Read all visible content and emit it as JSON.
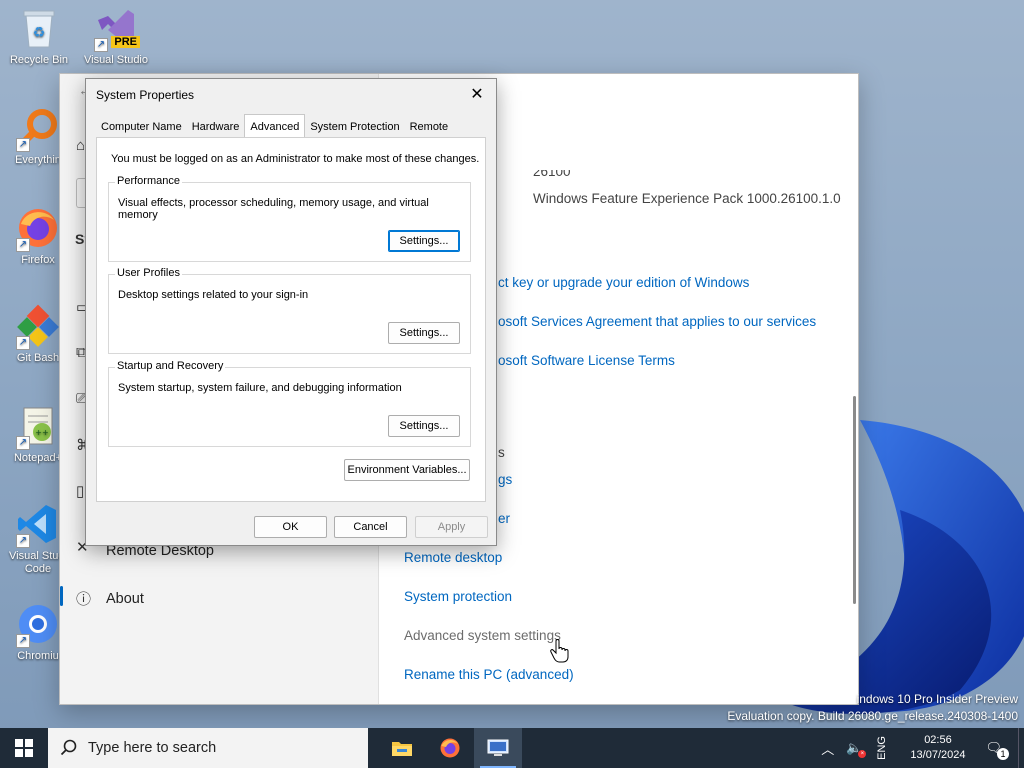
{
  "desktop": {
    "icons": [
      {
        "label": "Recycle Bin",
        "icon": "recycle-bin-icon"
      },
      {
        "label": "Visual Studio",
        "badge": "PRE",
        "icon": "visual-studio-icon"
      },
      {
        "label": "Everythin",
        "icon": "everything-search-icon"
      },
      {
        "label": "Firefox",
        "icon": "firefox-icon"
      },
      {
        "label": "Git Bash",
        "icon": "git-bash-icon"
      },
      {
        "label": "Notepad+",
        "icon": "notepad-plus-plus-icon"
      },
      {
        "label": "Visual Studi Code",
        "icon": "vscode-icon"
      },
      {
        "label": "Chromiu",
        "icon": "chromium-icon"
      }
    ],
    "watermark": {
      "line1": "indows 10 Pro Insider Preview",
      "line2": "Evaluation copy. Build 26080.ge_release.240308-1400"
    }
  },
  "settings_window": {
    "nav": {
      "partial_label": "Sy",
      "items": [
        "Remote Desktop",
        "About"
      ]
    },
    "content": {
      "partial_version": "26100",
      "feature_pack": "Windows Feature Experience Pack 1000.26100.1.0",
      "links": [
        "ct key or upgrade your edition of Windows",
        "osoft Services Agreement that applies to our services",
        "osoft Software License Terms"
      ],
      "related_header_fragment": "s",
      "partial_links": [
        "gs",
        "er"
      ],
      "related_links": [
        {
          "label": "Remote desktop"
        },
        {
          "label": "System protection"
        },
        {
          "label": "Advanced system settings"
        },
        {
          "label": "Rename this PC (advanced)"
        }
      ]
    }
  },
  "dialog": {
    "title": "System Properties",
    "tabs": [
      "Computer Name",
      "Hardware",
      "Advanced",
      "System Protection",
      "Remote"
    ],
    "active_tab": "Advanced",
    "admin_note": "You must be logged on as an Administrator to make most of these changes.",
    "groups": [
      {
        "title": "Performance",
        "desc": "Visual effects, processor scheduling, memory usage, and virtual memory",
        "button": "Settings..."
      },
      {
        "title": "User Profiles",
        "desc": "Desktop settings related to your sign-in",
        "button": "Settings..."
      },
      {
        "title": "Startup and Recovery",
        "desc": "System startup, system failure, and debugging information",
        "button": "Settings..."
      }
    ],
    "env_button": "Environment Variables...",
    "ok": "OK",
    "cancel": "Cancel",
    "apply": "Apply"
  },
  "taskbar": {
    "search_placeholder": "Type here to search",
    "apps": [
      "file-explorer-icon",
      "firefox-icon",
      "system-properties-icon"
    ],
    "tray": {
      "language": "ENG",
      "time": "02:56",
      "date": "13/07/2024",
      "notification_badge": "1"
    }
  },
  "colors": {
    "link": "#0067c0",
    "taskbar": "#1f2b38",
    "accent": "#0078d4"
  }
}
